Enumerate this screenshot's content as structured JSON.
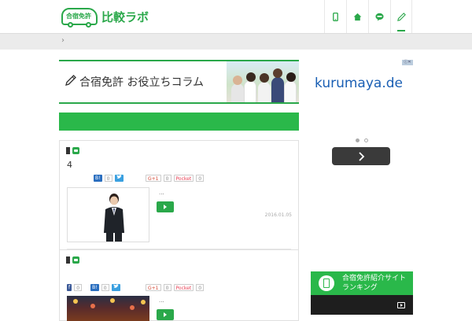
{
  "header": {
    "logo_car_text": "合宿免許",
    "logo_title": "比較ラボ",
    "nav_icons": [
      "mobile-icon",
      "home-icon",
      "line-icon",
      "pencil-icon"
    ],
    "accent_color": "#2aa84a"
  },
  "breadcrumb": {
    "separator": "›"
  },
  "banner": {
    "text": "合宿免許 お役立ちコラム"
  },
  "posts": [
    {
      "title": "4",
      "shares": {
        "hatena": "0",
        "twitter": "0",
        "gplus_label": "G+1",
        "gplus": "0",
        "pocket_label": "Pocket",
        "pocket": "0"
      },
      "excerpt": "...",
      "date": "2016.01.05"
    },
    {
      "title": "",
      "shares": {
        "facebook": "0",
        "hatena": "0",
        "twitter": "0",
        "gplus_label": "G+1",
        "gplus": "0",
        "pocket_label": "Pocket",
        "pocket": "0"
      },
      "excerpt": "..."
    }
  ],
  "hatena_label": "B!",
  "facebook_label": "f",
  "ad": {
    "badge": "ⓘ✕",
    "text": "kurumaya.de",
    "dots": 2,
    "active_dot": 0
  },
  "widget": {
    "title": "合宿免許紹介サイトランキング"
  }
}
